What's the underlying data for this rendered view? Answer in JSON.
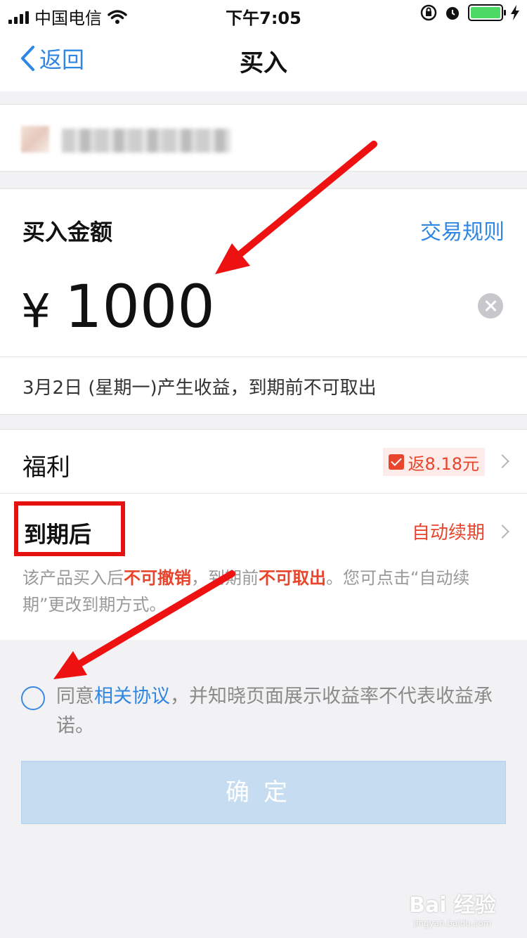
{
  "status_bar": {
    "carrier": "中国电信",
    "time": "下午7:05"
  },
  "nav": {
    "back_label": "返回",
    "title": "买入"
  },
  "amount": {
    "label": "买入金额",
    "rules_link": "交易规则",
    "currency": "¥",
    "value": "1000",
    "note": "3月2日 (星期一)产生收益，到期前不可取出"
  },
  "benefit": {
    "label": "福利",
    "rebate": "返8.18元"
  },
  "maturity": {
    "label": "到期后",
    "option": "自动续期",
    "desc_1": "该产品买入后",
    "desc_hl1": "不可撤销",
    "desc_2": "，到期前",
    "desc_hl2": "不可取出",
    "desc_3": "。您可点击“自动续期”更改到期方式。"
  },
  "agreement": {
    "prefix": "同意",
    "link": "相关协议",
    "suffix": "，并知晓页面展示收益率不代表收益承诺。"
  },
  "confirm_label": "确定",
  "watermark": {
    "main": "Bai 经验",
    "sub": "jingyan.baidu.com"
  },
  "colors": {
    "accent_blue": "#2f86e3",
    "highlight_red": "#e8452c",
    "annotation_red": "#e6120f"
  }
}
